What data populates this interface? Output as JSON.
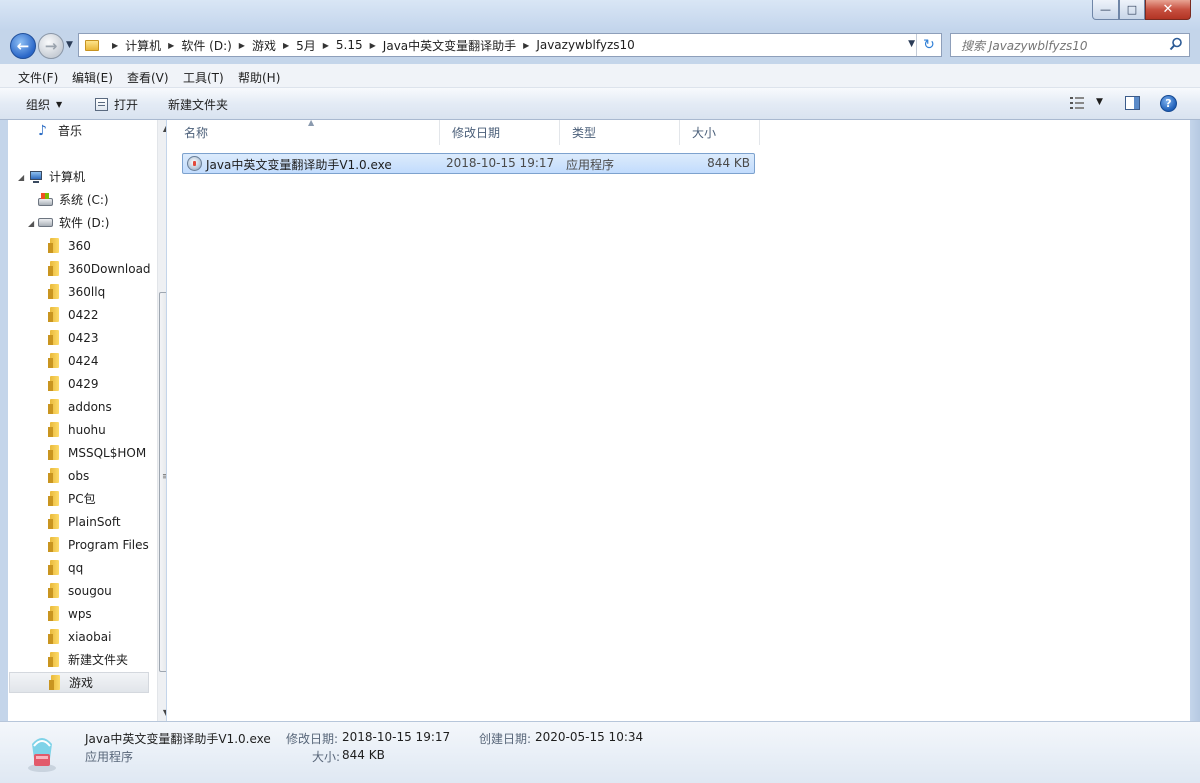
{
  "window": {
    "controls": {
      "minimize": "—",
      "maximize": "□",
      "close": "✕"
    }
  },
  "nav": {
    "back_icon": "←",
    "forward_icon": "→",
    "breadcrumbs": [
      "计算机",
      "软件 (D:)",
      "游戏",
      "5月",
      "5.15",
      "Java中英文变量翻译助手",
      "Javazywblfyzs10"
    ],
    "search_placeholder": "搜索 Javazywblfyzs10"
  },
  "menubar": {
    "file": "文件(F)",
    "edit": "编辑(E)",
    "view": "查看(V)",
    "tools": "工具(T)",
    "help": "帮助(H)"
  },
  "commandbar": {
    "organize": "组织",
    "open": "打开",
    "new_folder": "新建文件夹",
    "help_glyph": "?"
  },
  "navpane": {
    "music": "音乐",
    "computer": "计算机",
    "drive_c": "系统 (C:)",
    "drive_d": "软件 (D:)",
    "folders": [
      "360",
      "360Download",
      "360llq",
      "0422",
      "0423",
      "0424",
      "0429",
      "addons",
      "huohu",
      "MSSQL$HOM",
      "obs",
      "PC包",
      "PlainSoft",
      "Program Files",
      "qq",
      "sougou",
      "wps",
      "xiaobai",
      "新建文件夹",
      "游戏"
    ],
    "selected_folder": "游戏"
  },
  "columns": {
    "name": "名称",
    "modified": "修改日期",
    "type": "类型",
    "size": "大小"
  },
  "files": [
    {
      "name": "Java中英文变量翻译助手V1.0.exe",
      "modified": "2018-10-15 19:17",
      "type": "应用程序",
      "size": "844 KB"
    }
  ],
  "details": {
    "filename": "Java中英文变量翻译助手V1.0.exe",
    "filetype": "应用程序",
    "modified_label": "修改日期:",
    "modified_value": "2018-10-15 19:17",
    "created_label": "创建日期:",
    "created_value": "2020-05-15 10:34",
    "size_label": "大小:",
    "size_value": "844 KB"
  }
}
